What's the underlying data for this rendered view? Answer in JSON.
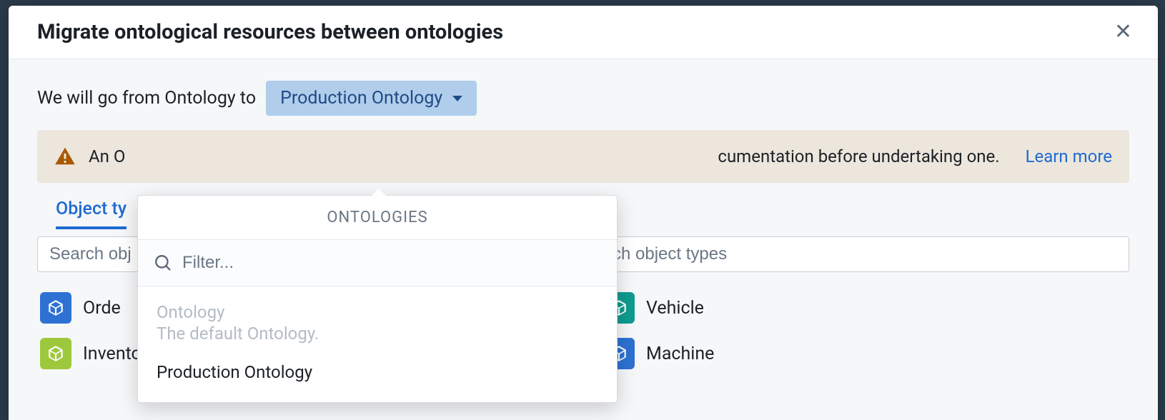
{
  "modal": {
    "title": "Migrate ontological resources between ontologies",
    "direction_prefix": "We will go from Ontology to",
    "target_label": "Production Ontology",
    "warning_prefix": "An O",
    "warning_suffix": "cumentation before undertaking one.",
    "learn_more": "Learn more"
  },
  "tabs": {
    "active": "Object ty"
  },
  "left": {
    "search_placeholder": "Search obj",
    "items": [
      {
        "label": "Orde",
        "color": "blue"
      },
      {
        "label": "Inventory",
        "color": "green"
      }
    ]
  },
  "right": {
    "search_placeholder": "ch object types",
    "items": [
      {
        "label": "Vehicle",
        "color": "teal"
      },
      {
        "label": "Machine",
        "color": "blue2"
      }
    ]
  },
  "popover": {
    "heading": "ONTOLOGIES",
    "filter_placeholder": "Filter...",
    "options": [
      {
        "title": "Ontology",
        "subtitle": "The default Ontology.",
        "disabled": true
      },
      {
        "title": "Production Ontology",
        "subtitle": "",
        "disabled": false
      }
    ]
  }
}
